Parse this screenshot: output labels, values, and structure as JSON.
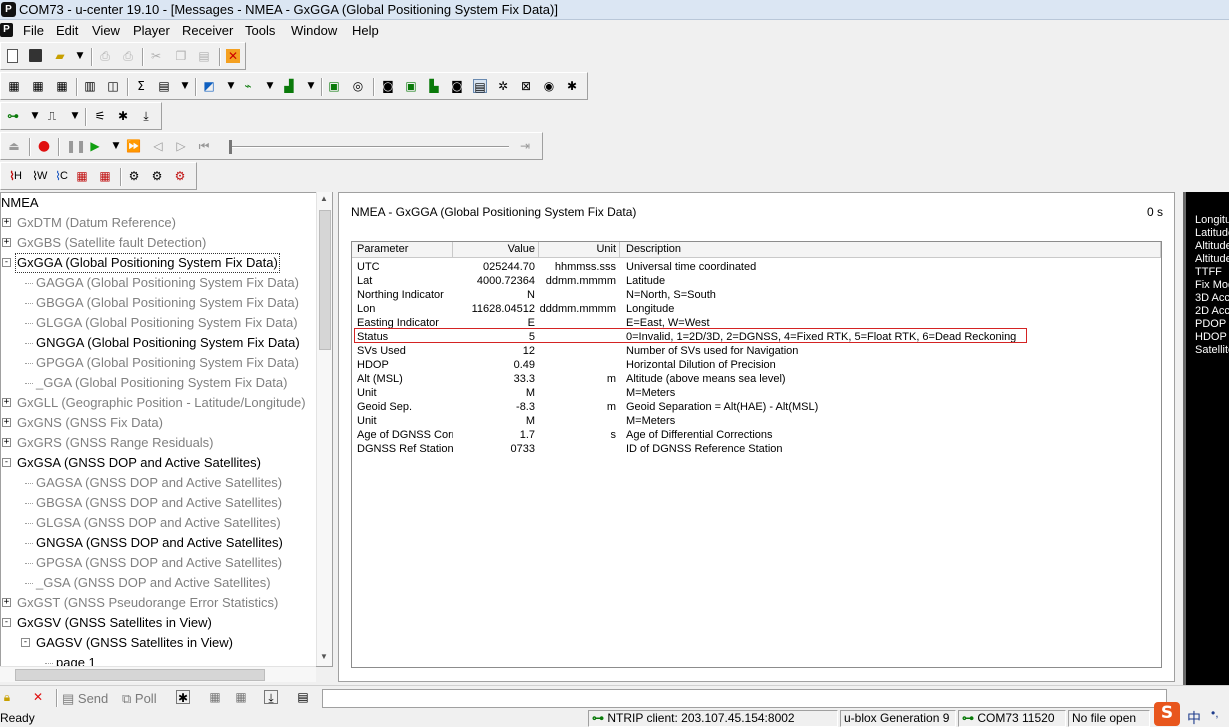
{
  "window": {
    "title": "COM73 - u-center 19.10 - [Messages - NMEA - GxGGA (Global Positioning System Fix Data)]",
    "icon_letter": "P"
  },
  "menu": {
    "items": [
      "File",
      "Edit",
      "View",
      "Player",
      "Receiver",
      "Tools",
      "Window",
      "Help"
    ]
  },
  "toolbar_icons": [
    "new-icon",
    "save-icon",
    "open-icon",
    "print-icon",
    "print-preview-icon",
    "cut-icon",
    "copy-icon",
    "paste-icon",
    "close-icon",
    "database-icon",
    "text-console-icon",
    "packet-console-icon",
    "table-view-icon",
    "tree-view-icon",
    "sum-icon",
    "grid-icon",
    "chart-view-icon",
    "histogram-icon",
    "deviation-map-icon",
    "sky-view-icon",
    "world-map-icon",
    "camera-icon",
    "satellite-icon",
    "signal-icon",
    "table-icon",
    "navigation-icon",
    "compass-icon",
    "clock-icon",
    "gps-icon",
    "record-icon",
    "pause-icon",
    "play-icon",
    "fast-forward-icon",
    "step-back-icon",
    "step-forward-icon",
    "rewind-icon",
    "slider-end-icon"
  ],
  "player": {
    "receiver_labels": [
      "H",
      "W",
      "C"
    ]
  },
  "tree": {
    "root": "NMEA",
    "items": [
      {
        "label": "GxDTM (Datum Reference)",
        "style": "grey",
        "level": 0,
        "expander": "+"
      },
      {
        "label": "GxGBS (Satellite fault Detection)",
        "style": "grey",
        "level": 0,
        "expander": "+"
      },
      {
        "label": "GxGGA (Global Positioning System Fix Data)",
        "style": "selected",
        "level": 0,
        "expander": "-"
      },
      {
        "label": "GAGGA (Global Positioning System Fix Data)",
        "style": "grey",
        "level": 1
      },
      {
        "label": "GBGGA (Global Positioning System Fix Data)",
        "style": "grey",
        "level": 1
      },
      {
        "label": "GLGGA (Global Positioning System Fix Data)",
        "style": "grey",
        "level": 1
      },
      {
        "label": "GNGGA (Global Positioning System Fix Data)",
        "style": "black",
        "level": 1
      },
      {
        "label": "GPGGA (Global Positioning System Fix Data)",
        "style": "grey",
        "level": 1
      },
      {
        "label": "_GGA (Global Positioning System Fix Data)",
        "style": "grey",
        "level": 1
      },
      {
        "label": "GxGLL (Geographic Position - Latitude/Longitude)",
        "style": "grey",
        "level": 0,
        "expander": "+"
      },
      {
        "label": "GxGNS (GNSS Fix Data)",
        "style": "grey",
        "level": 0,
        "expander": "+"
      },
      {
        "label": "GxGRS (GNSS Range Residuals)",
        "style": "grey",
        "level": 0,
        "expander": "+"
      },
      {
        "label": "GxGSA (GNSS DOP and Active Satellites)",
        "style": "black",
        "level": 0,
        "expander": "-"
      },
      {
        "label": "GAGSA (GNSS DOP and Active Satellites)",
        "style": "grey",
        "level": 1
      },
      {
        "label": "GBGSA (GNSS DOP and Active Satellites)",
        "style": "grey",
        "level": 1
      },
      {
        "label": "GLGSA (GNSS DOP and Active Satellites)",
        "style": "grey",
        "level": 1
      },
      {
        "label": "GNGSA (GNSS DOP and Active Satellites)",
        "style": "black",
        "level": 1
      },
      {
        "label": "GPGSA (GNSS DOP and Active Satellites)",
        "style": "grey",
        "level": 1
      },
      {
        "label": "_GSA (GNSS DOP and Active Satellites)",
        "style": "grey",
        "level": 1
      },
      {
        "label": "GxGST (GNSS Pseudorange Error Statistics)",
        "style": "grey",
        "level": 0,
        "expander": "+"
      },
      {
        "label": "GxGSV (GNSS Satellites in View)",
        "style": "black",
        "level": 0,
        "expander": "-"
      },
      {
        "label": "GAGSV (GNSS Satellites in View)",
        "style": "black",
        "level": 1,
        "expander": "-"
      },
      {
        "label": "page 1",
        "style": "black",
        "level": 2
      }
    ]
  },
  "panel": {
    "title": "NMEA - GxGGA (Global Positioning System Fix Data)",
    "time": "0 s",
    "columns": [
      "Parameter",
      "Value",
      "Unit",
      "Description"
    ],
    "rows": [
      {
        "param": "UTC",
        "value": "025244.70",
        "unit": "hhmmss.sss",
        "desc": "Universal time coordinated"
      },
      {
        "param": "Lat",
        "value": "4000.72364",
        "unit": "ddmm.mmmm",
        "desc": "Latitude"
      },
      {
        "param": "Northing Indicator",
        "value": "N",
        "unit": "",
        "desc": "N=North, S=South"
      },
      {
        "param": "Lon",
        "value": "11628.04512",
        "unit": "dddmm.mmmm",
        "desc": "Longitude"
      },
      {
        "param": "Easting Indicator",
        "value": "E",
        "unit": "",
        "desc": "E=East, W=West"
      },
      {
        "param": "Status",
        "value": "5",
        "unit": "",
        "desc": "0=Invalid, 1=2D/3D, 2=DGNSS, 4=Fixed RTK, 5=Float RTK, 6=Dead Reckoning"
      },
      {
        "param": "SVs Used",
        "value": "12",
        "unit": "",
        "desc": "Number of SVs used for Navigation"
      },
      {
        "param": "HDOP",
        "value": "0.49",
        "unit": "",
        "desc": "Horizontal Dilution of Precision"
      },
      {
        "param": "Alt (MSL)",
        "value": "33.3",
        "unit": "m",
        "desc": "Altitude (above means sea level)"
      },
      {
        "param": "Unit",
        "value": "M",
        "unit": "",
        "desc": "M=Meters"
      },
      {
        "param": "Geoid Sep.",
        "value": "-8.3",
        "unit": "m",
        "desc": "Geoid Separation = Alt(HAE) - Alt(MSL)"
      },
      {
        "param": "Unit",
        "value": "M",
        "unit": "",
        "desc": "M=Meters"
      },
      {
        "param": "Age of DGNSS Corr",
        "value": "1.7",
        "unit": "s",
        "desc": "Age of Differential Corrections"
      },
      {
        "param": "DGNSS Ref Station",
        "value": "0733",
        "unit": "",
        "desc": "ID of DGNSS Reference Station"
      }
    ]
  },
  "right_panel": {
    "labels": [
      "Longitu",
      "Latitude",
      "Altitude",
      "Altitude",
      "TTFF",
      "Fix Mod",
      "3D Acc",
      "2D Acc",
      "PDOP",
      "HDOP",
      "Satellite"
    ]
  },
  "bottombar": {
    "send_label": "Send",
    "poll_label": "Poll"
  },
  "status": {
    "ready": "Ready",
    "ntrip": "NTRIP client: 203.107.45.154:8002",
    "generation": "u-blox Generation 9",
    "port": "COM73 11520",
    "file": "No file open",
    "ime": "中"
  },
  "colors": {
    "highlight_border": "#d42323",
    "titlebar": "#dbe6f3",
    "right_panel": "#000000"
  }
}
